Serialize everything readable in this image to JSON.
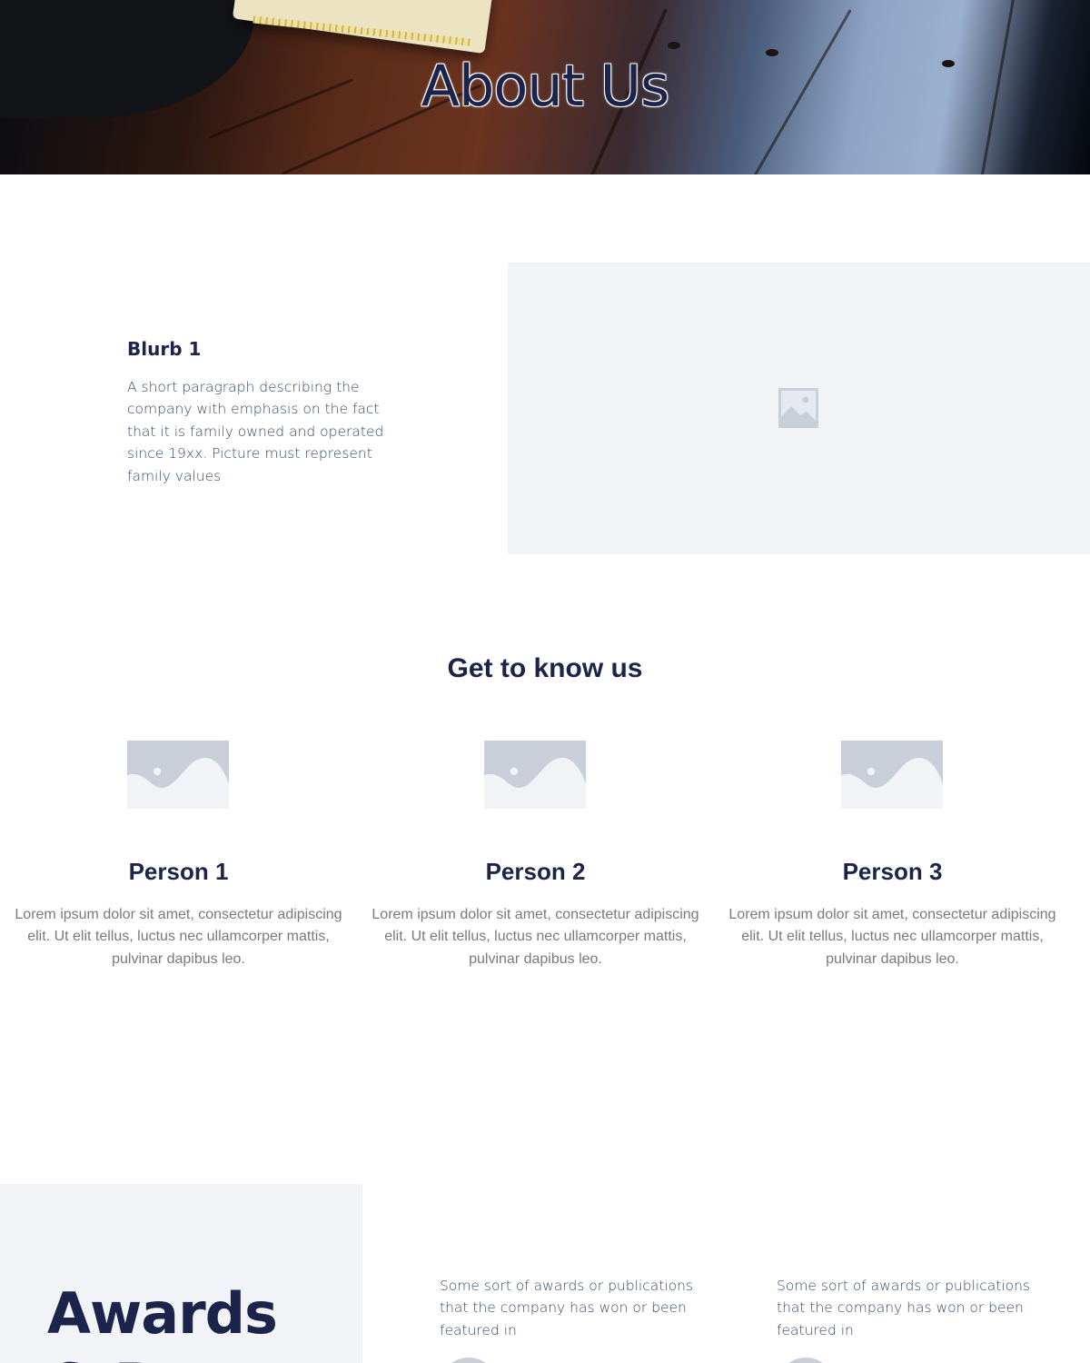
{
  "hero": {
    "title": "About Us"
  },
  "blurb": {
    "title": "Blurb 1",
    "text": "A short paragraph describing the company with emphasis on the fact that it is family owned and operated since 19xx. Picture must represent family values"
  },
  "team": {
    "heading": "Get to know us",
    "members": [
      {
        "name": "Person 1",
        "bio": "Lorem ipsum dolor sit amet, consectetur adipiscing elit. Ut elit tellus, luctus nec ullamcorper mattis, pulvinar dapibus leo."
      },
      {
        "name": "Person 2",
        "bio": "Lorem ipsum dolor sit amet, consectetur adipiscing elit. Ut elit tellus, luctus nec ullamcorper mattis, pulvinar dapibus leo."
      },
      {
        "name": "Person 3",
        "bio": "Lorem ipsum dolor sit amet, consectetur adipiscing elit. Ut elit tellus, luctus nec ullamcorper mattis, pulvinar dapibus leo."
      }
    ]
  },
  "awards": {
    "title_line1": "Awards",
    "title_line2": "& P",
    "items": [
      {
        "text": "Some sort of awards or publications that the company has won or been featured in"
      },
      {
        "text": "Some sort of awards or publications that the company has won or been featured in"
      }
    ]
  },
  "colors": {
    "primary": "#1c244b",
    "body_text": "#324a6d",
    "muted_text": "#7a7a7a",
    "panel_bg": "#f2f3f7",
    "placeholder": "#c8cfd8"
  },
  "icons": {
    "blurb_image": "image-placeholder-icon",
    "member_photo": "photo-placeholder-icon"
  }
}
